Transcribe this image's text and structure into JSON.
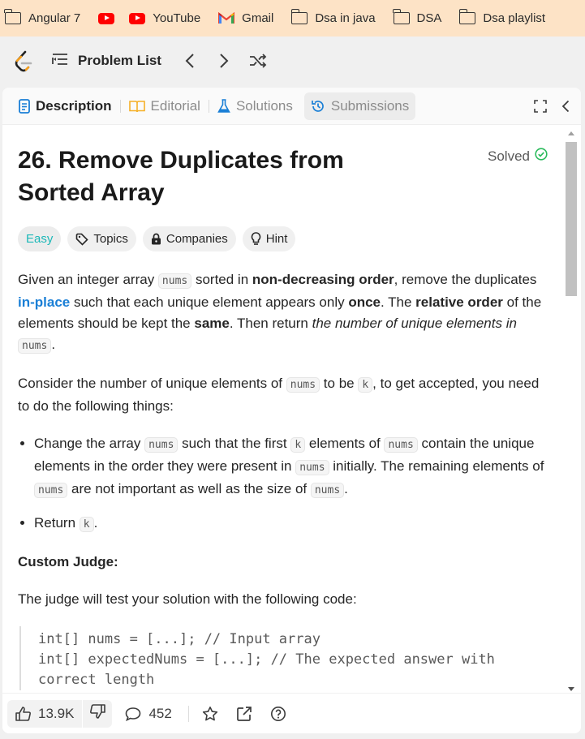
{
  "bookmarks": [
    {
      "label": "Angular 7",
      "icon": "folder-icon"
    },
    {
      "label": "",
      "icon": "youtube-icon"
    },
    {
      "label": "YouTube",
      "icon": "youtube-icon"
    },
    {
      "label": "Gmail",
      "icon": "gmail-icon"
    },
    {
      "label": "Dsa in java",
      "icon": "folder-icon"
    },
    {
      "label": "DSA",
      "icon": "folder-icon"
    },
    {
      "label": "Dsa playlist",
      "icon": "folder-icon"
    }
  ],
  "nav": {
    "problem_list": "Problem List"
  },
  "tabs": {
    "description": "Description",
    "editorial": "Editorial",
    "solutions": "Solutions",
    "submissions": "Submissions"
  },
  "problem": {
    "title": "26. Remove Duplicates from Sorted Array",
    "status": "Solved",
    "difficulty": "Easy",
    "chips": {
      "topics": "Topics",
      "companies": "Companies",
      "hint": "Hint"
    },
    "code_nums": "nums",
    "code_k": "k",
    "p1": {
      "a": "Given an integer array ",
      "b": " sorted in ",
      "c": "non-decreasing order",
      "d": ", remove the duplicates ",
      "e": "in-place",
      "f": " such that each unique element appears only ",
      "g": "once",
      "h": ". The ",
      "i": "relative order",
      "j": " of the elements should be kept the ",
      "k": "same",
      "l": ". Then return ",
      "m": "the number of unique elements in ",
      "n": "."
    },
    "p2": {
      "a": "Consider the number of unique elements of ",
      "b": " to be ",
      "c": ", to get accepted, you need to do the following things:"
    },
    "li1": {
      "a": "Change the array ",
      "b": " such that the first ",
      "c": " elements of ",
      "d": " contain the unique elements in the order they were present in ",
      "e": " initially. The remaining elements of ",
      "f": " are not important as well as the size of ",
      "g": "."
    },
    "li2": {
      "a": "Return ",
      "b": "."
    },
    "judge_heading": "Custom Judge:",
    "judge_text": "The judge will test your solution with the following code:",
    "code": "int[] nums = [...]; // Input array\nint[] expectedNums = [...]; // The expected answer with correct length"
  },
  "footer": {
    "likes": "13.9K",
    "comments": "452"
  },
  "colors": {
    "bookmarks_bg": "#fde3c6",
    "easy": "#1cb8b8",
    "link": "#1a7fd6",
    "solved_check": "#2cbb5d"
  }
}
